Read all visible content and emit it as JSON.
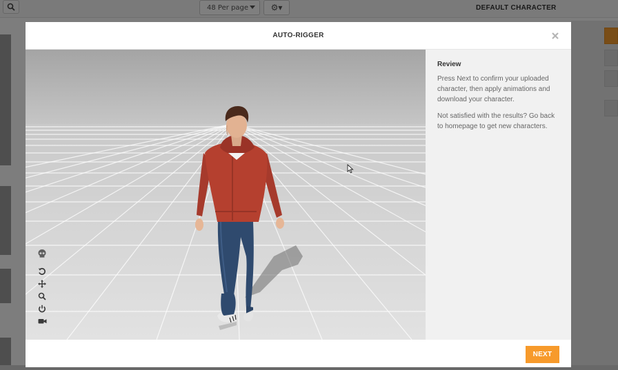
{
  "background": {
    "per_page_label": "48 Per page",
    "header_title": "DEFAULT CHARACTER"
  },
  "modal": {
    "title": "AUTO-RIGGER",
    "review": {
      "heading": "Review",
      "paragraph_1": "Press Next to confirm your uploaded character, then apply animations and download your character.",
      "paragraph_2": "Not satisfied with the results? Go back to homepage to get new characters."
    },
    "next_label": "NEXT"
  },
  "viewer": {
    "tools": [
      "skeleton-icon",
      "reset-icon",
      "move-icon",
      "zoom-icon",
      "power-icon",
      "camera-icon"
    ]
  },
  "colors": {
    "accent": "#f79a2b",
    "panel_bg": "#f1f1f1",
    "hoodie": "#b5402f",
    "jeans": "#2f4a6e"
  }
}
